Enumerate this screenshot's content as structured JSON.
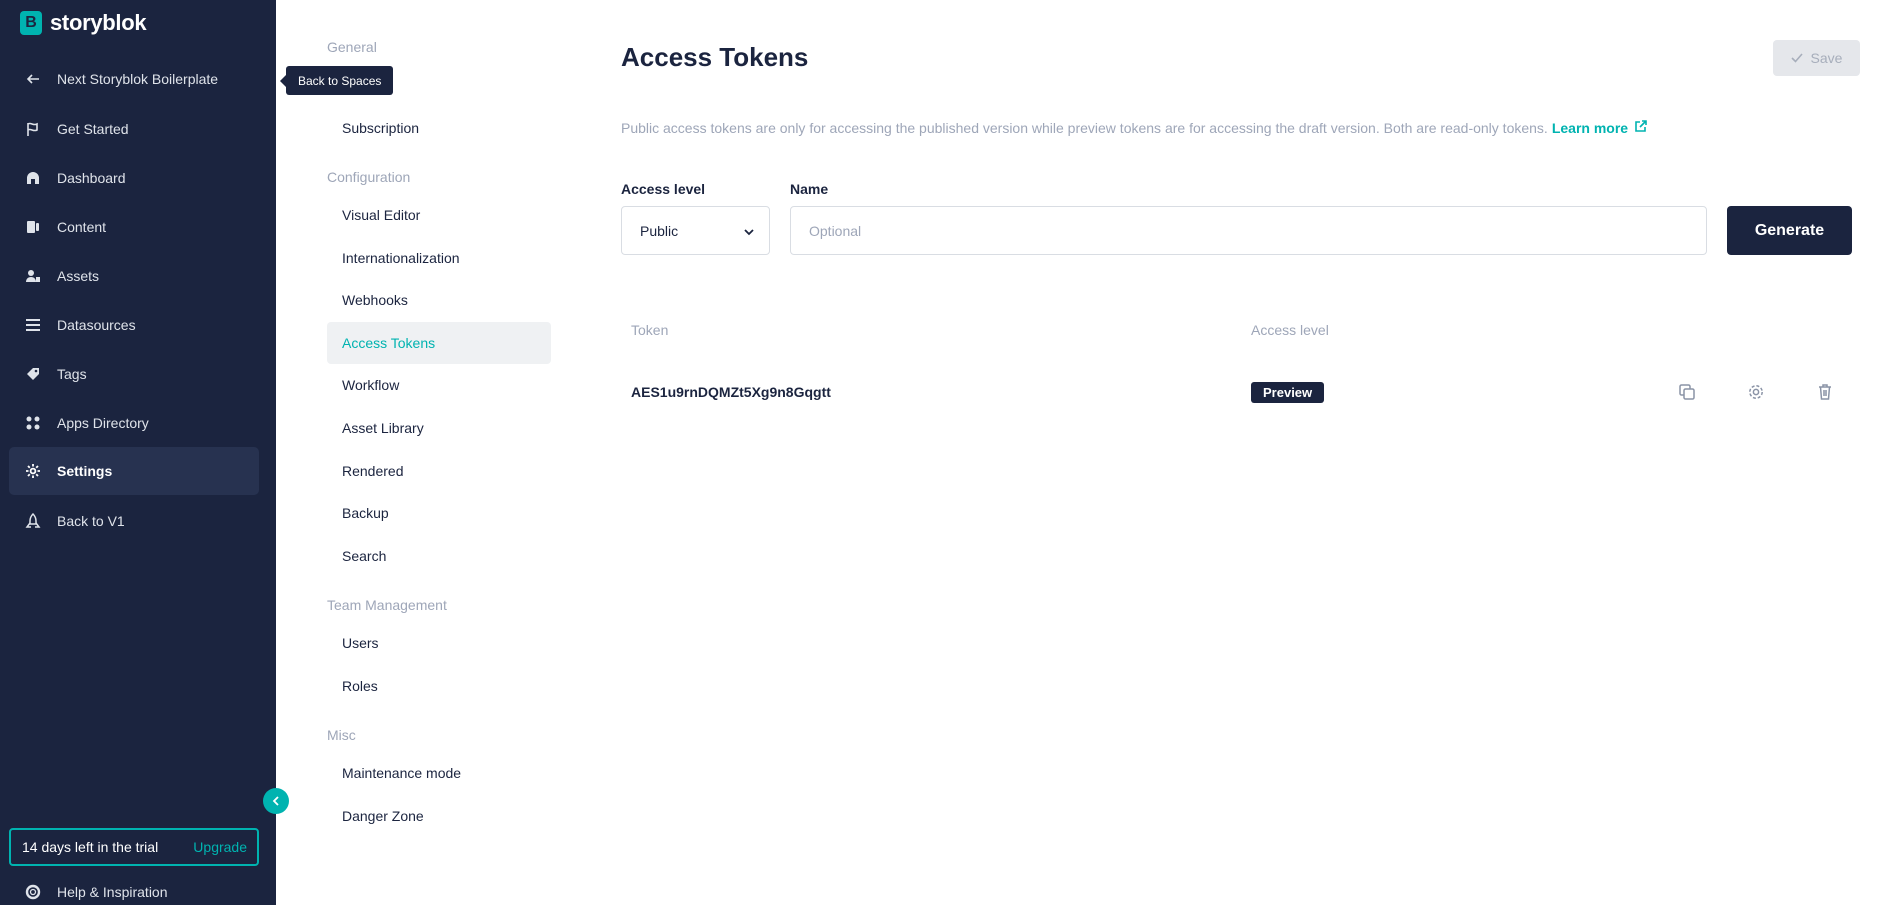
{
  "brand": {
    "name": "storyblok",
    "mark": "B"
  },
  "nav": {
    "back_label": "Next Storyblok Boilerplate",
    "tooltip": "Back to Spaces",
    "items": [
      {
        "label": "Get Started",
        "icon": "flag-icon"
      },
      {
        "label": "Dashboard",
        "icon": "dashboard-icon"
      },
      {
        "label": "Content",
        "icon": "content-icon"
      },
      {
        "label": "Assets",
        "icon": "assets-icon"
      },
      {
        "label": "Datasources",
        "icon": "datasources-icon"
      },
      {
        "label": "Tags",
        "icon": "tag-icon"
      },
      {
        "label": "Apps Directory",
        "icon": "apps-icon"
      },
      {
        "label": "Settings",
        "icon": "gear-icon"
      },
      {
        "label": "Back to V1",
        "icon": "rocket-icon"
      }
    ],
    "trial_text": "14 days left in the trial",
    "upgrade_label": "Upgrade",
    "help_label": "Help & Inspiration"
  },
  "settings_menu": {
    "sections": {
      "general": "General",
      "configuration": "Configuration",
      "team": "Team Management",
      "misc": "Misc"
    },
    "items": {
      "subscription": "Subscription",
      "visual_editor": "Visual Editor",
      "internationalization": "Internationalization",
      "webhooks": "Webhooks",
      "access_tokens": "Access Tokens",
      "workflow": "Workflow",
      "asset_library": "Asset Library",
      "rendered": "Rendered",
      "backup": "Backup",
      "search": "Search",
      "users": "Users",
      "roles": "Roles",
      "maintenance": "Maintenance mode",
      "danger": "Danger Zone"
    }
  },
  "main": {
    "title": "Access Tokens",
    "save_label": "Save",
    "description": "Public access tokens are only for accessing the published version while preview tokens are for accessing the draft version. Both are read-only tokens.",
    "learn_more": "Learn more",
    "access_level_label": "Access level",
    "access_level_value": "Public",
    "name_label": "Name",
    "name_placeholder": "Optional",
    "generate_label": "Generate",
    "table": {
      "col_token": "Token",
      "col_access": "Access level",
      "rows": [
        {
          "token": "AES1u9rnDQMZt5Xg9n8Gqgtt",
          "access": "Preview"
        }
      ]
    }
  },
  "colors": {
    "nav_bg": "#1b243f",
    "accent": "#00b3b0",
    "muted": "#9ea6b8"
  }
}
